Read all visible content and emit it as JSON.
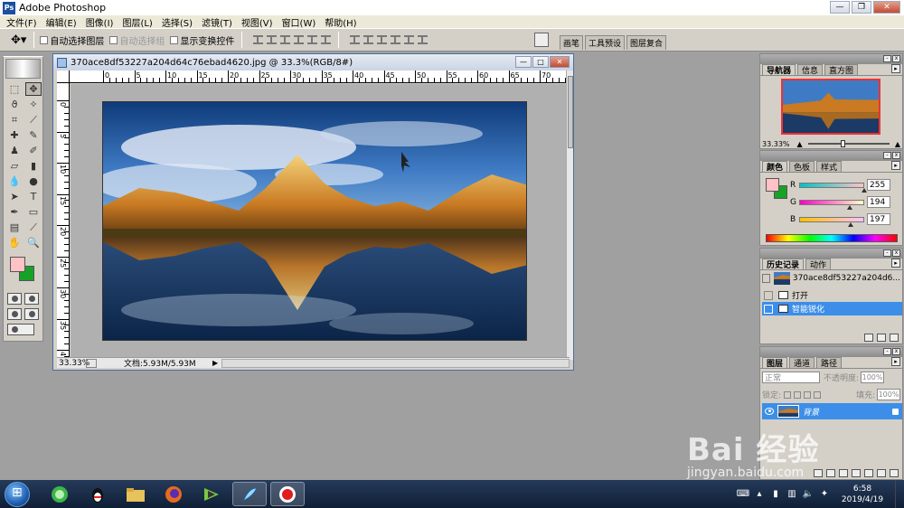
{
  "app": {
    "title": "Adobe Photoshop"
  },
  "menu": [
    "文件(F)",
    "编辑(E)",
    "图像(I)",
    "图层(L)",
    "选择(S)",
    "滤镜(T)",
    "视图(V)",
    "窗口(W)",
    "帮助(H)"
  ],
  "options": {
    "auto_select_layer": "自动选择图层",
    "auto_select_group": "自动选择组",
    "show_transform": "显示变换控件",
    "well_tabs": [
      "画笔",
      "工具预设",
      "图层复合"
    ]
  },
  "document": {
    "title": "370ace8df53227a204d64c76ebad4620.jpg @ 33.3%(RGB/8#)",
    "zoom": "33.33%",
    "doc_info": "文档:5.93M/5.93M",
    "ruler_h_labels": [
      "0",
      "5",
      "10",
      "15",
      "20",
      "25",
      "30",
      "35",
      "40",
      "45",
      "50",
      "55",
      "60",
      "65",
      "70"
    ],
    "ruler_v_labels": [
      "0",
      "5",
      "1 0",
      "1 5",
      "2 0",
      "2 5",
      "3 0",
      "3 5",
      "4"
    ]
  },
  "navigator": {
    "tabs": [
      "导航器",
      "信息",
      "直方图"
    ],
    "zoom": "33.33%"
  },
  "color": {
    "tabs": [
      "颜色",
      "色板",
      "样式"
    ],
    "r_label": "R",
    "g_label": "G",
    "b_label": "B",
    "r": "255",
    "g": "194",
    "b": "197",
    "fg_color": "#ffc2c5",
    "bg_color": "#16a226"
  },
  "history": {
    "tabs": [
      "历史记录",
      "动作"
    ],
    "source": "370ace8df53227a204d6...",
    "items": [
      {
        "label": "打开",
        "selected": false
      },
      {
        "label": "智能锐化",
        "selected": true
      }
    ]
  },
  "layers": {
    "tabs": [
      "图层",
      "通道",
      "路径"
    ],
    "blend_mode": "正常",
    "opacity_label": "不透明度:",
    "opacity": "100%",
    "lock_label": "锁定:",
    "fill_label": "填充:",
    "fill": "100%",
    "layer_name": "背景"
  },
  "taskbar": {
    "time": "6:58",
    "date": "2019/4/19"
  },
  "watermark": {
    "brand": "Bai 经验",
    "url": "jingyan.baidu.com"
  }
}
